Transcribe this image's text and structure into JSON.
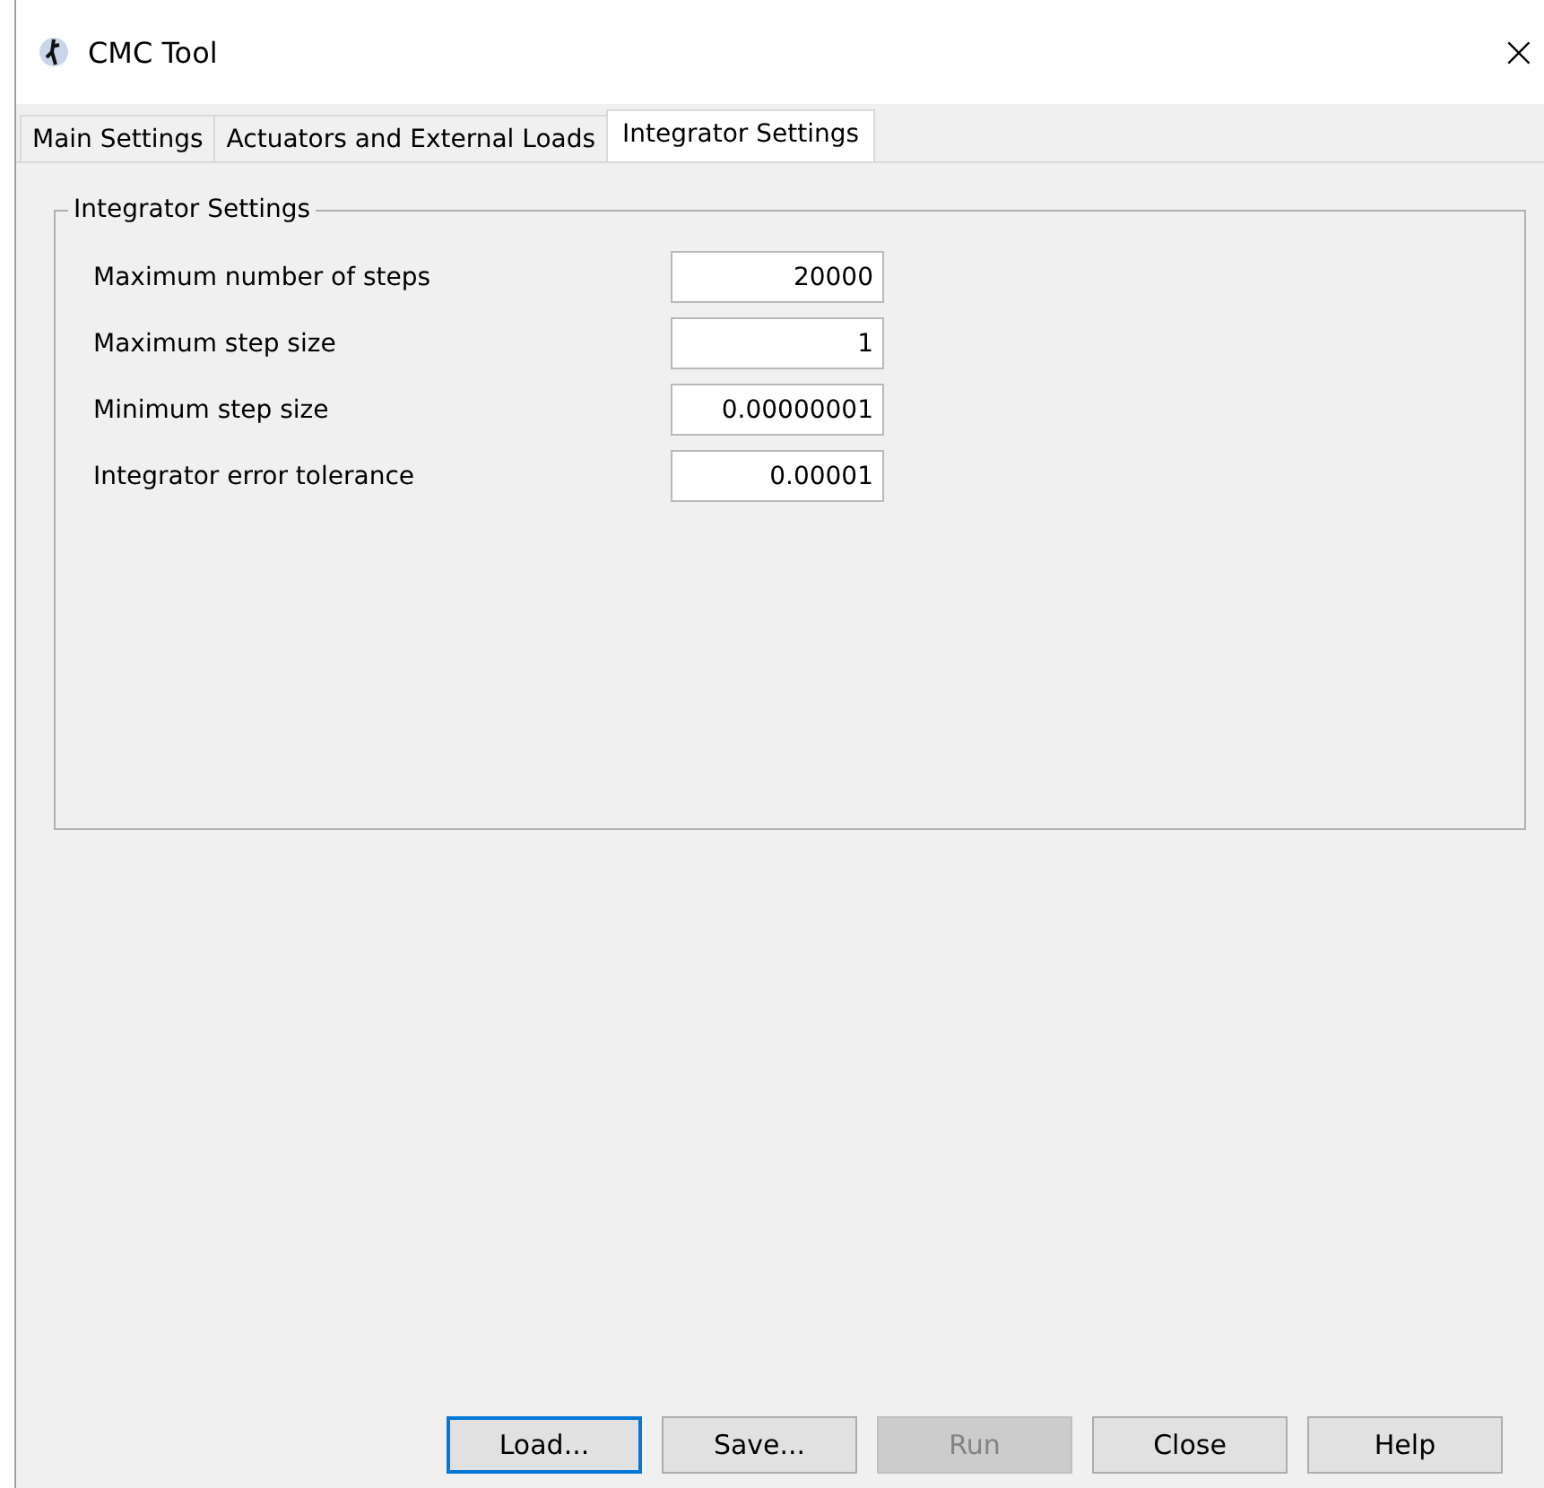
{
  "window": {
    "title": "CMC Tool",
    "close": "×"
  },
  "tabs": [
    {
      "label": "Main Settings",
      "selected": false
    },
    {
      "label": "Actuators and External Loads",
      "selected": false
    },
    {
      "label": "Integrator Settings",
      "selected": true
    }
  ],
  "group": {
    "title": "Integrator Settings",
    "fields": [
      {
        "label": "Maximum number of steps",
        "value": "20000"
      },
      {
        "label": "Maximum step size",
        "value": "1"
      },
      {
        "label": "Minimum step size",
        "value": "0.00000001"
      },
      {
        "label": "Integrator error tolerance",
        "value": "0.00001"
      }
    ]
  },
  "buttons": [
    {
      "label": "Load...",
      "focused": true,
      "disabled": false
    },
    {
      "label": "Save...",
      "focused": false,
      "disabled": false
    },
    {
      "label": "Run",
      "focused": false,
      "disabled": true
    },
    {
      "label": "Close",
      "focused": false,
      "disabled": false
    },
    {
      "label": "Help",
      "focused": false,
      "disabled": false
    }
  ]
}
